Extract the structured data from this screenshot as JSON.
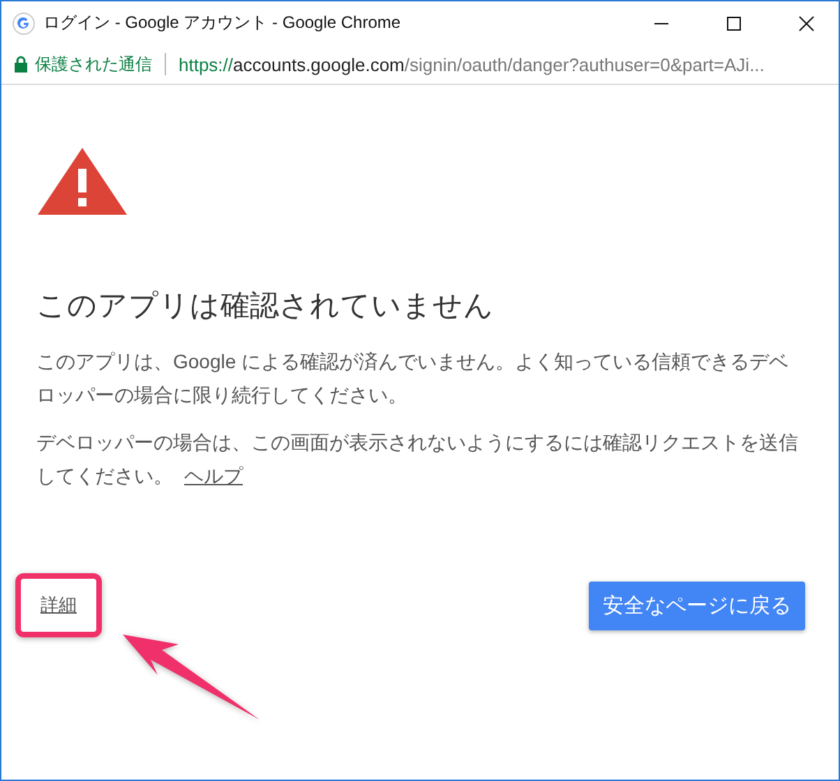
{
  "window": {
    "title": "ログイン - Google アカウント - Google Chrome"
  },
  "address_bar": {
    "security_label": "保護された通信",
    "url": {
      "scheme": "https://",
      "host": "accounts.google.com",
      "path": "/signin/oauth/danger?authuser=0&part=AJi..."
    }
  },
  "heading": "このアプリは確認されていません",
  "paragraphs": [
    {
      "text": "このアプリは、Google による確認が済んでいません。よく知っている信頼できるデベロッパーの場合に限り続行してください。"
    },
    {
      "text": "デベロッパーの場合は、この画面が表示されないようにするには確認リクエストを送信してください。",
      "link": "ヘルプ"
    }
  ],
  "details_link": {
    "label": "詳細",
    "highlighted": true
  },
  "back_button": "安全なページに戻る"
}
